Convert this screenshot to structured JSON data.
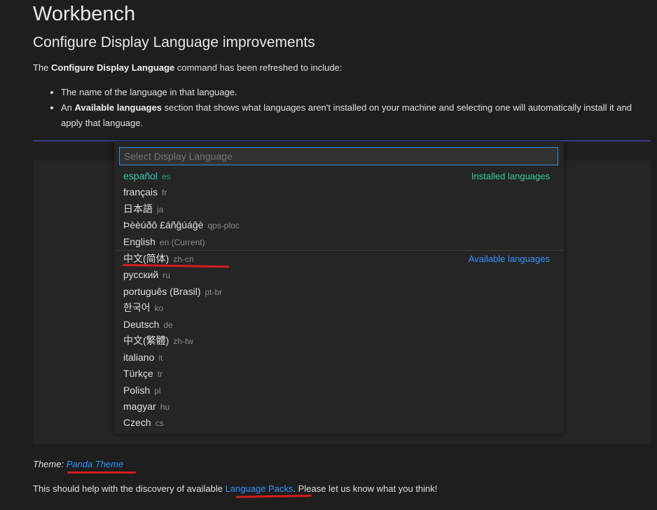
{
  "doc": {
    "title": "Workbench",
    "section_heading": "Configure Display Language improvements",
    "intro": {
      "prefix": "The ",
      "command": "Configure Display Language",
      "suffix": " command has been refreshed to include:"
    },
    "bullets": [
      {
        "text": "The name of the language in that language."
      },
      {
        "prefix": "An ",
        "bold": "Available languages",
        "suffix": " section that shows what languages aren't installed on your machine and selecting one will automatically install it and apply that language."
      }
    ],
    "theme": {
      "label": "Theme: ",
      "link": "Panda Theme"
    },
    "footer": {
      "prefix": "This should help with the discovery of available ",
      "link": "Language Packs",
      "suffix": ". Please let us know what you think!"
    }
  },
  "picker": {
    "placeholder": "Select Display Language",
    "installed_label": "Installed languages",
    "available_label": "Available languages",
    "installed": [
      {
        "name": "español",
        "code": "es"
      },
      {
        "name": "français",
        "code": "fr"
      },
      {
        "name": "日本語",
        "code": "ja"
      },
      {
        "name": "Þèèúðô £áñĝúáĝè",
        "code": "qps-ploc"
      },
      {
        "name": "English",
        "code": "en (Current)"
      }
    ],
    "available": [
      {
        "name": "中文(简体)",
        "code": "zh-cn"
      },
      {
        "name": "русский",
        "code": "ru"
      },
      {
        "name": "português (Brasil)",
        "code": "pt-br"
      },
      {
        "name": "한국어",
        "code": "ko"
      },
      {
        "name": "Deutsch",
        "code": "de"
      },
      {
        "name": "中文(繁體)",
        "code": "zh-tw"
      },
      {
        "name": "italiano",
        "code": "it"
      },
      {
        "name": "Türkçe",
        "code": "tr"
      },
      {
        "name": "Polish",
        "code": "pl"
      },
      {
        "name": "magyar",
        "code": "hu"
      },
      {
        "name": "Czech",
        "code": "cs"
      }
    ]
  },
  "colors": {
    "background": "#1e1e1e",
    "accent_link": "#3794ff",
    "installed_accent": "#2fcf9b",
    "annotation_red": "#d41d1d"
  }
}
